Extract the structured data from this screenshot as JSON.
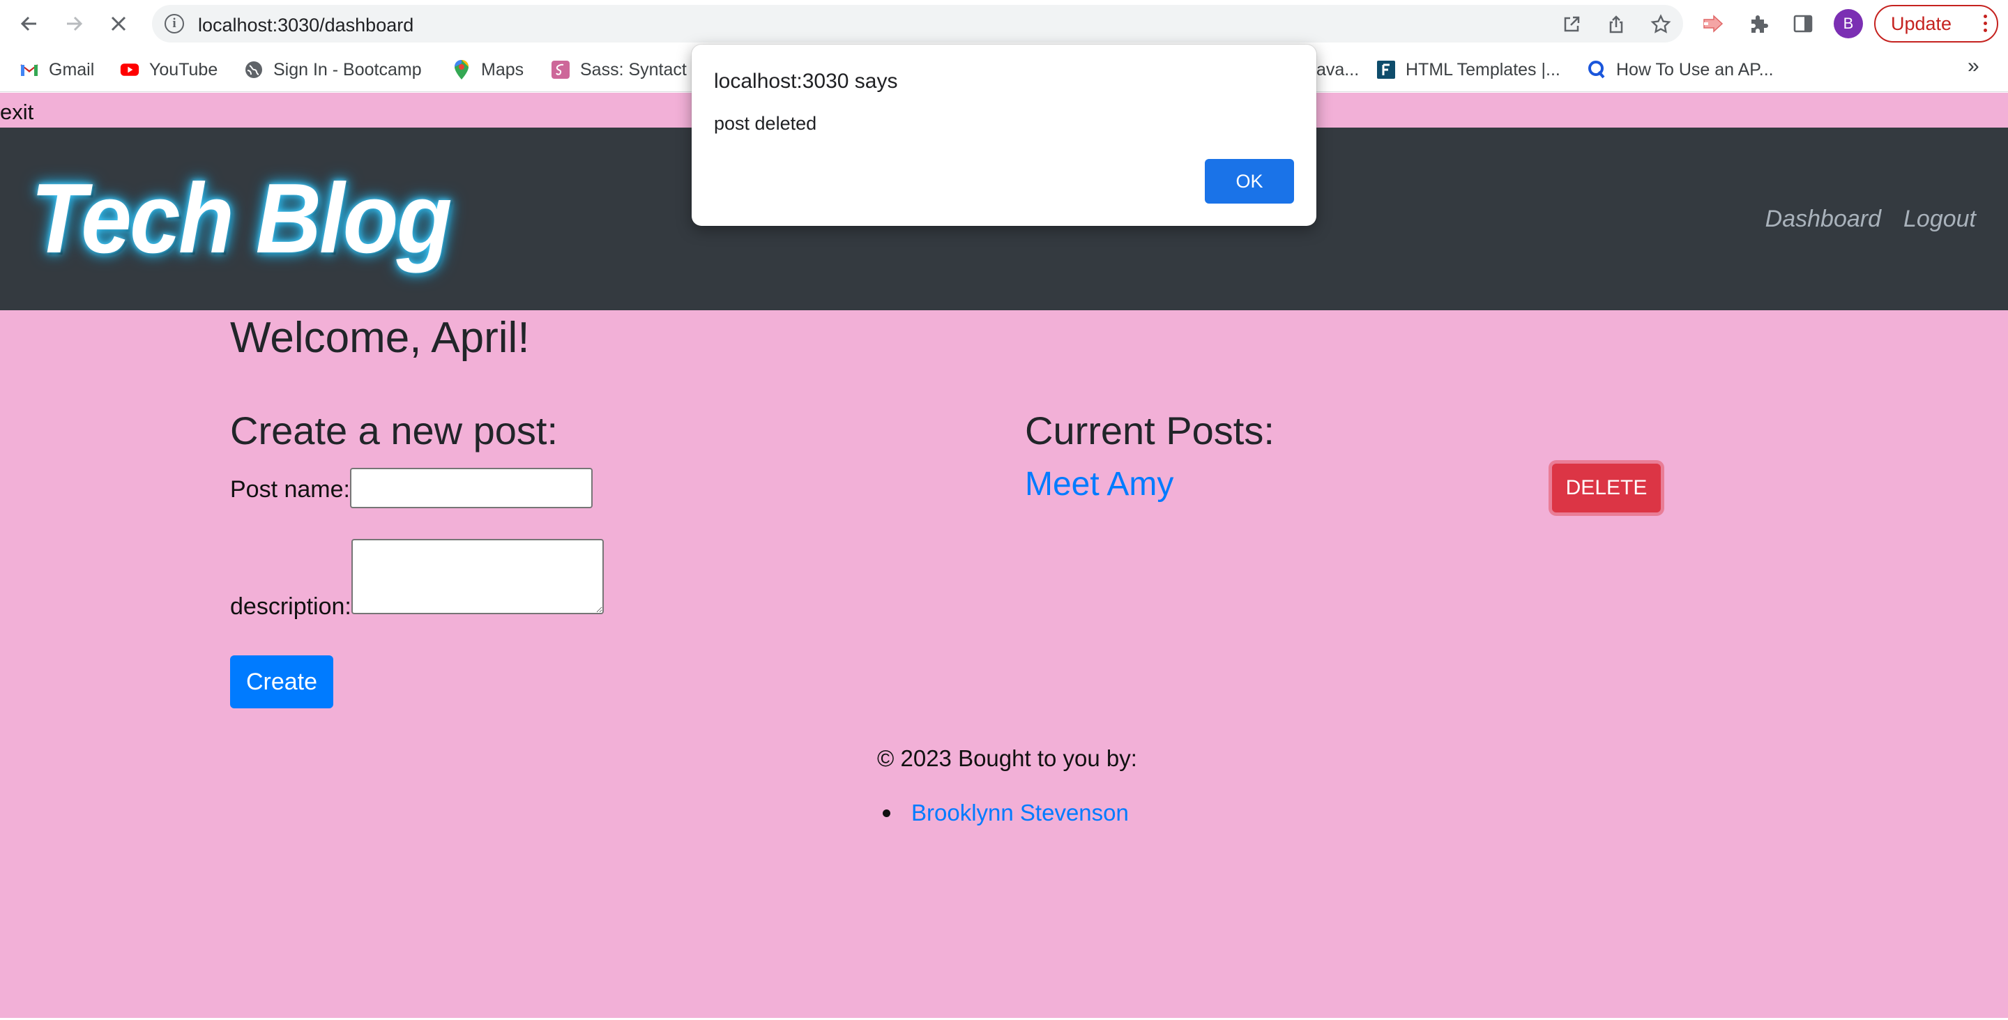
{
  "browser": {
    "url": "localhost:3030/dashboard",
    "avatar_letter": "B",
    "update_label": "Update",
    "bookmarks": [
      "Gmail",
      "YouTube",
      "Sign In - Bootcamp",
      "Maps",
      "Sass: Syntact",
      "ava...",
      "HTML Templates |...",
      "How To Use an AP..."
    ],
    "more_bookmarks": "»",
    "colors": {
      "update": "#c5221f",
      "avatar": "#7b2fb3"
    }
  },
  "page": {
    "exit_text": "exit",
    "logo": "Tech Blog",
    "nav": {
      "dashboard": "Dashboard",
      "logout": "Logout"
    },
    "welcome": "Welcome, April!",
    "create": {
      "title": "Create a new post:",
      "post_name_label": "Post name:",
      "post_name_value": "",
      "description_label": "description:",
      "description_value": "",
      "button": "Create"
    },
    "posts": {
      "title": "Current Posts:",
      "items": [
        {
          "name": "Meet Amy",
          "delete_label": "DELETE"
        }
      ]
    },
    "footer": {
      "text": "© 2023 Bought to you by:",
      "authors": [
        "Brooklynn Stevenson"
      ]
    },
    "colors": {
      "background": "#f2b0d7",
      "header": "#343a40",
      "primary": "#007bff",
      "danger": "#dc3545"
    }
  },
  "dialog": {
    "title": "localhost:3030 says",
    "message": "post deleted",
    "ok_label": "OK"
  }
}
